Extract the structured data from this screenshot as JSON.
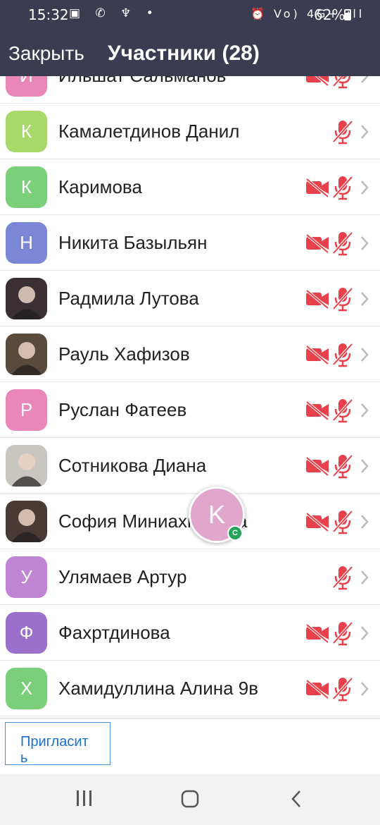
{
  "status_bar": {
    "time": "15:32",
    "left_icons": "▣ ✆ ♆ •",
    "right_icons": "⏰ Vo) 4G+ ıll",
    "battery": "62%"
  },
  "header": {
    "close_label": "Закрыть",
    "title": "Участники (28)"
  },
  "participants": [
    {
      "initial": "И",
      "name": "Ильшат Сальманов",
      "avatar_color": "#e887b8",
      "photo": false,
      "video_off": true,
      "muted": true
    },
    {
      "initial": "К",
      "name": "Камалетдинов Данил",
      "avatar_color": "#a8d86a",
      "photo": false,
      "video_off": false,
      "muted": true
    },
    {
      "initial": "К",
      "name": "Каримова",
      "avatar_color": "#7ccf7a",
      "photo": false,
      "video_off": true,
      "muted": true
    },
    {
      "initial": "Н",
      "name": "Никита Базыльян",
      "avatar_color": "#7b86d6",
      "photo": false,
      "video_off": true,
      "muted": true
    },
    {
      "initial": "",
      "name": "Радмила Лутова",
      "avatar_color": "#3a3034",
      "photo": true,
      "video_off": true,
      "muted": true
    },
    {
      "initial": "",
      "name": "Рауль Хафизов",
      "avatar_color": "#5a4a3c",
      "photo": true,
      "video_off": true,
      "muted": true
    },
    {
      "initial": "Р",
      "name": "Руслан Фатеев",
      "avatar_color": "#e887b8",
      "photo": false,
      "video_off": true,
      "muted": true
    },
    {
      "initial": "",
      "name": "Сотникова Диана",
      "avatar_color": "#c9c5c0",
      "photo": true,
      "video_off": true,
      "muted": true
    },
    {
      "initial": "",
      "name": "София Миниахметова",
      "avatar_color": "#4a3a36",
      "photo": true,
      "video_off": true,
      "muted": true
    },
    {
      "initial": "У",
      "name": "Улямаев Артур",
      "avatar_color": "#c084d4",
      "photo": false,
      "video_off": false,
      "muted": true
    },
    {
      "initial": "Ф",
      "name": "Фахртдинова",
      "avatar_color": "#9b6fcc",
      "photo": false,
      "video_off": true,
      "muted": true
    },
    {
      "initial": "Х",
      "name": "Хамидуллина Алина 9в",
      "avatar_color": "#7ccf7a",
      "photo": false,
      "video_off": true,
      "muted": true
    }
  ],
  "floating_avatar": {
    "initial": "K",
    "badge": "C"
  },
  "footer": {
    "invite_label": "Пригласит\nь"
  },
  "icons": {
    "camera": "video-off-icon",
    "microphone": "mic-off-icon",
    "chevron": "chevron-right-icon",
    "muted_color": "#e8414b"
  }
}
